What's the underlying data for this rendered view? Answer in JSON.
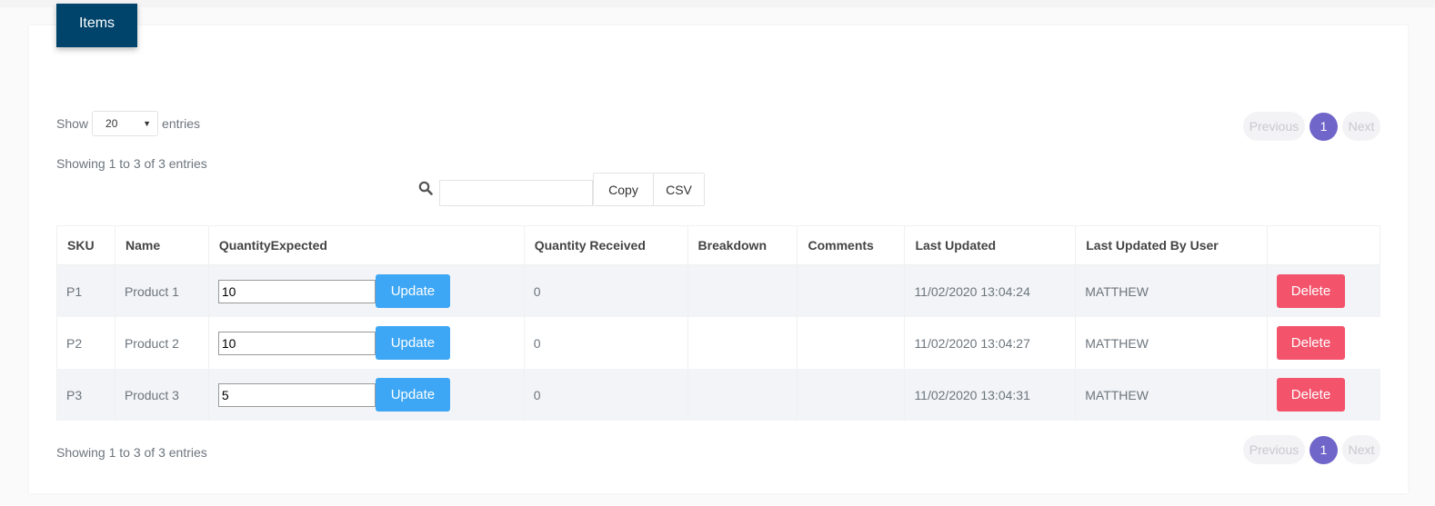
{
  "tab": {
    "label": "Items"
  },
  "length": {
    "show_label": "Show",
    "selected": "20",
    "entries_label": "entries"
  },
  "info_text": "Showing 1 to 3 of 3 entries",
  "pagination": {
    "previous": "Previous",
    "page": "1",
    "next": "Next"
  },
  "search": {
    "value": ""
  },
  "export": {
    "copy": "Copy",
    "csv": "CSV"
  },
  "table": {
    "columns": [
      "SKU",
      "Name",
      "QuantityExpected",
      "Quantity Received",
      "Breakdown",
      "Comments",
      "Last Updated",
      "Last Updated By User",
      ""
    ],
    "rows": [
      {
        "sku": "P1",
        "name": "Product 1",
        "qty_expected": "10",
        "qty_received": "0",
        "breakdown": "",
        "comments": "",
        "last_updated": "11/02/2020 13:04:24",
        "user": "MATTHEW"
      },
      {
        "sku": "P2",
        "name": "Product 2",
        "qty_expected": "10",
        "qty_received": "0",
        "breakdown": "",
        "comments": "",
        "last_updated": "11/02/2020 13:04:27",
        "user": "MATTHEW"
      },
      {
        "sku": "P3",
        "name": "Product 3",
        "qty_expected": "5",
        "qty_received": "0",
        "breakdown": "",
        "comments": "",
        "last_updated": "11/02/2020 13:04:31",
        "user": "MATTHEW"
      }
    ],
    "update_label": "Update",
    "delete_label": "Delete"
  },
  "colors": {
    "tab_bg": "#00436b",
    "update": "#3ea7f5",
    "delete": "#f3546c",
    "page_active": "#7065c9"
  },
  "icons": {
    "search": "search-icon",
    "select_caret": "caret-down-icon"
  }
}
